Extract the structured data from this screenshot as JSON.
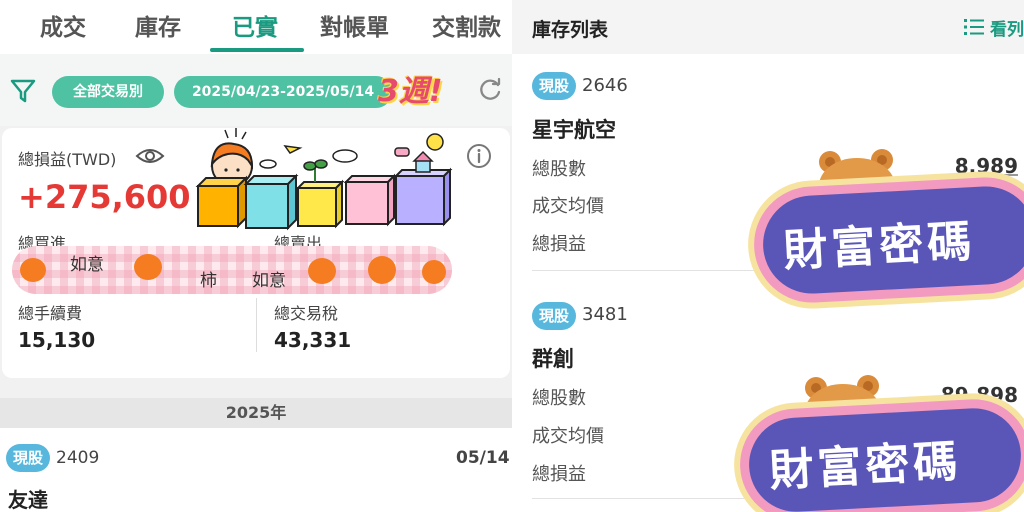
{
  "left": {
    "tabs": [
      "成交",
      "庫存",
      "已實",
      "對帳單",
      "交割款"
    ],
    "active_tab": "已實",
    "filter": {
      "trade_type": "全部交易別",
      "date_range": "2025/04/23-2025/05/14",
      "sticker_text": "3週!"
    },
    "summary": {
      "total_pl_label": "總損益(TWD)",
      "total_pl_value": "+275,600",
      "total_buy_label": "總買進",
      "total_sell_label": "總賣出",
      "fee_label": "總手續費",
      "fee_value": "15,130",
      "tax_label": "總交易稅",
      "tax_value": "43,331",
      "overlay_text_1": "如意",
      "overlay_text_2": "柿",
      "overlay_text_3": "如意"
    },
    "year_header": "2025年",
    "list": [
      {
        "badge": "現股",
        "code": "2409",
        "name": "友達",
        "date": "05/14"
      }
    ]
  },
  "right": {
    "title": "庫存列表",
    "view_label": "看列",
    "sticker_text": "財富密碼",
    "items": [
      {
        "badge": "現股",
        "code": "2646",
        "name": "星宇航空",
        "shares_label": "總股數",
        "shares_value": "8,989",
        "avg_label": "成交均價",
        "pl_label": "總損益"
      },
      {
        "badge": "現股",
        "code": "3481",
        "name": "群創",
        "shares_label": "總股數",
        "shares_value": "89,898",
        "avg_label": "成交均價",
        "pl_label": "總損益"
      }
    ]
  },
  "colors": {
    "accent": "#1a9a80",
    "pill": "#4fc2a3",
    "badge": "#57b7dc",
    "profit": "#e53935",
    "sticker_fill": "#5a56b8",
    "sticker_border": "#f29ac0"
  },
  "icons": [
    "filter-icon",
    "refresh-icon",
    "eye-icon",
    "info-icon",
    "list-view-icon"
  ]
}
